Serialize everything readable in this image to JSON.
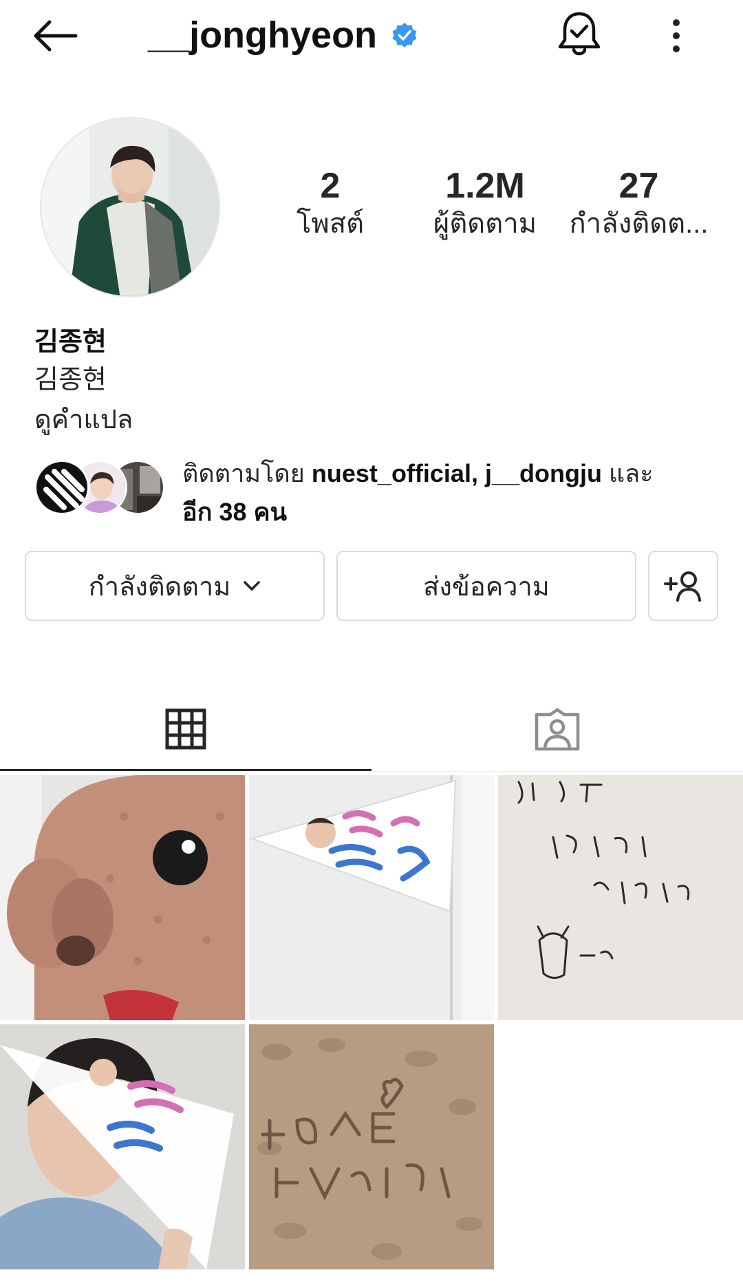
{
  "header": {
    "username": "__jonghyeon",
    "verified": true,
    "icons": [
      "back-arrow-icon",
      "verified-badge-icon",
      "notification-bell-icon",
      "more-options-icon"
    ]
  },
  "profile": {
    "stats": {
      "posts_count": "2",
      "posts_label": "โพสต์",
      "followers_count": "1.2M",
      "followers_label": "ผู้ติดตาม",
      "following_count": "27",
      "following_label": "กำลังติดต..."
    },
    "bio": {
      "name": "김종현",
      "line": "김종현",
      "translate": "ดูคำแปล"
    },
    "followed_by": {
      "prefix": "ติดตามโดย ",
      "users": "nuest_official, j__dongju",
      "connector": " และ",
      "others": "อีก 38 คน"
    }
  },
  "actions": {
    "following_label": "กำลังติดตาม",
    "message_label": "ส่งข้อความ"
  },
  "tabs": {
    "grid": "grid-icon",
    "tagged": "tagged-person-icon"
  },
  "colors": {
    "verified": "#3897f0",
    "text": "#262626",
    "border": "#dbdbdb"
  }
}
